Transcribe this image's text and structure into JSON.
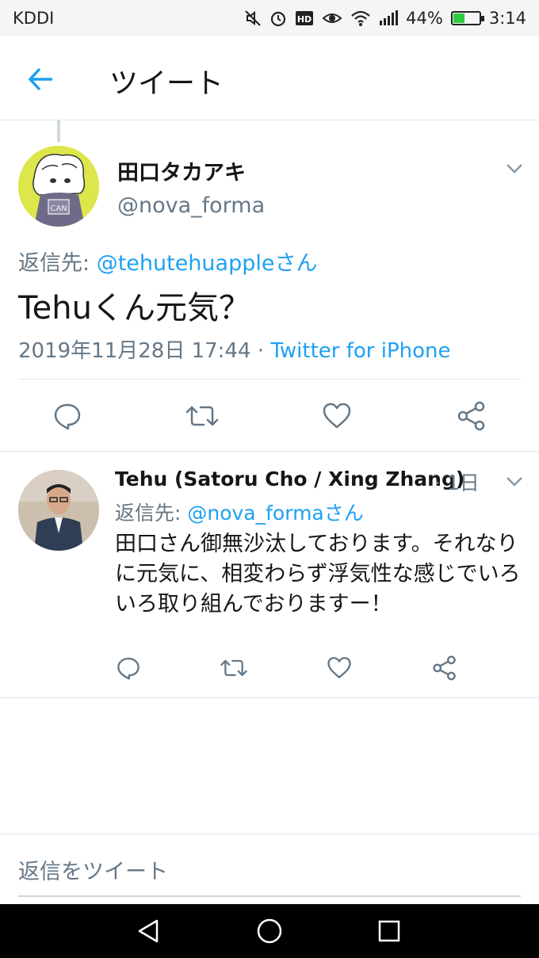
{
  "status_bar": {
    "carrier": "KDDI",
    "battery_text": "44%",
    "battery_level": 0.44,
    "time": "3:14",
    "icons": [
      "mute-icon",
      "alarm-icon",
      "hd-icon",
      "eye-icon",
      "wifi-icon",
      "signal-icon",
      "battery-icon"
    ]
  },
  "header": {
    "title": "ツイート",
    "back_icon": "back-arrow-icon"
  },
  "main_tweet": {
    "display_name": "田口タカアキ",
    "handle": "@nova_forma",
    "reply_prefix": "返信先: ",
    "reply_to": "@tehutehuappleさん",
    "text": "Tehuくん元気？",
    "timestamp": "2019年11月28日 17:44 · ",
    "source": "Twitter for iPhone",
    "actions": [
      "reply-icon",
      "retweet-icon",
      "like-icon",
      "share-icon"
    ]
  },
  "reply_tweet": {
    "display_name": "Tehu (Satoru Cho / Xing Zhang)",
    "time": " · 1日",
    "reply_prefix": "返信先: ",
    "reply_to": "@nova_formaさん",
    "text": "田口さん御無沙汰しております。それなりに元気に、相変わらず浮気性な感じでいろいろ取り組んでおりますー！",
    "actions": [
      "reply-icon",
      "retweet-icon",
      "like-icon",
      "share-icon"
    ]
  },
  "compose": {
    "placeholder": "返信をツイート"
  },
  "colors": {
    "accent": "#1da1f2",
    "secondary_text": "#657786",
    "divider": "#e1e8ed"
  }
}
